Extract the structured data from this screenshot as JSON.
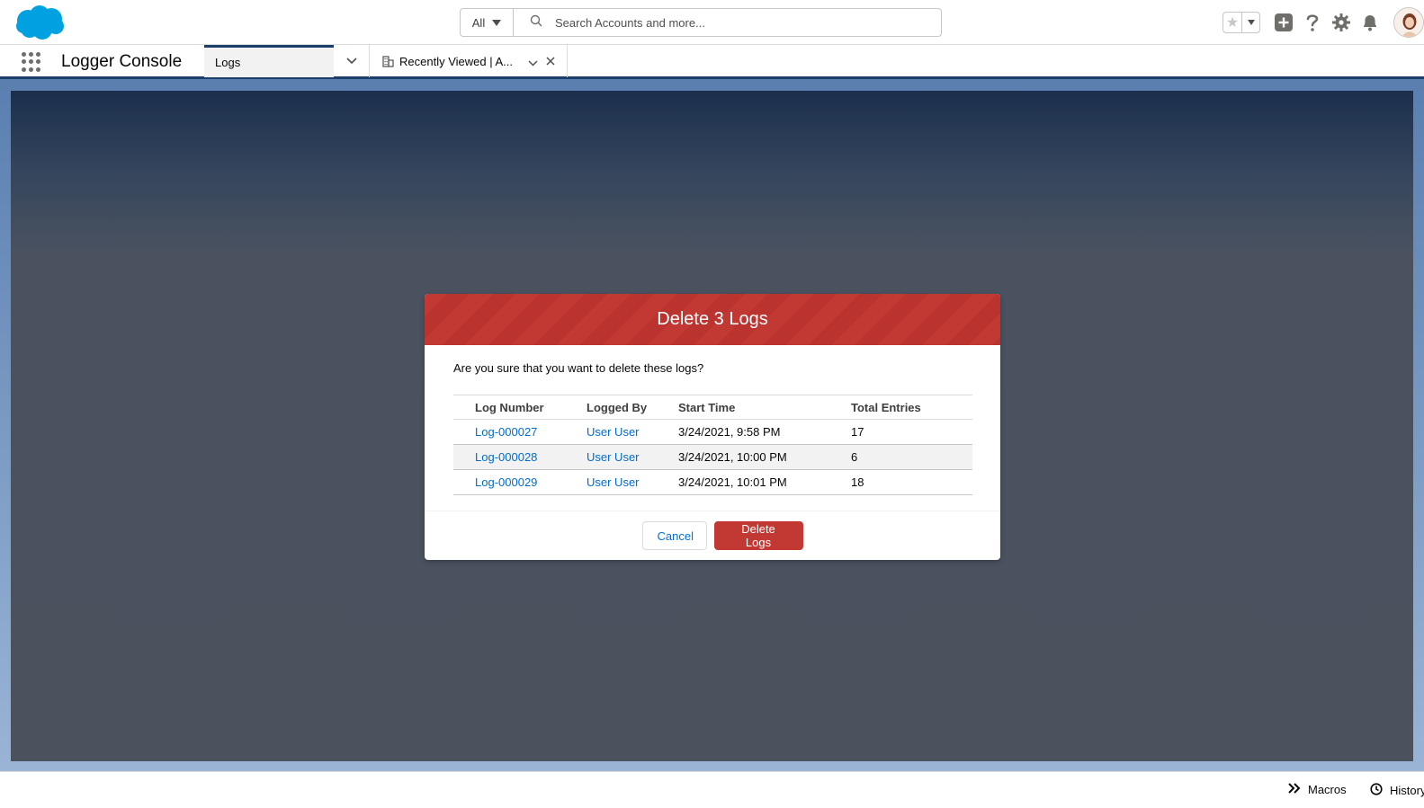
{
  "header": {
    "search_scope": "All",
    "search_placeholder": "Search Accounts and more...",
    "brand_color": "#00a1e0"
  },
  "nav": {
    "app_name": "Logger Console",
    "active_tab": "Logs",
    "subtab_label": "Recently Viewed | A...",
    "accent_color": "#1b3e6b"
  },
  "modal": {
    "title": "Delete 3 Logs",
    "question": "Are you sure that you want to delete these logs?",
    "columns": [
      "Log Number",
      "Logged By",
      "Start Time",
      "Total Entries"
    ],
    "rows": [
      {
        "log_number": "Log-000027",
        "logged_by": "User User",
        "start_time": "3/24/2021, 9:58 PM",
        "total_entries": "17"
      },
      {
        "log_number": "Log-000028",
        "logged_by": "User User",
        "start_time": "3/24/2021, 10:00 PM",
        "total_entries": "6"
      },
      {
        "log_number": "Log-000029",
        "logged_by": "User User",
        "start_time": "3/24/2021, 10:01 PM",
        "total_entries": "18"
      }
    ],
    "cancel_label": "Cancel",
    "confirm_label": "Delete Logs",
    "header_color": "#c23934",
    "link_color": "#006dcc"
  },
  "utility_bar": {
    "macros_label": "Macros",
    "history_label": "History"
  },
  "icons": {
    "logo": "salesforce-cloud-logo",
    "search": "search-icon",
    "favorites": "star-icon",
    "global_actions": "add-icon",
    "help": "help-icon",
    "setup": "gear-icon",
    "notifications": "bell-icon",
    "app_launcher": "waffle-icon",
    "subtab": "account-icon",
    "macros": "macros-icon",
    "history": "clock-icon"
  }
}
